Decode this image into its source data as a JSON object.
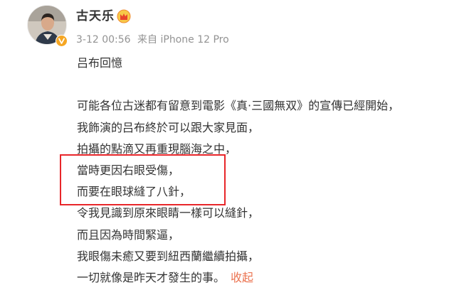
{
  "post": {
    "author": {
      "name": "古天乐",
      "avatar_icon": "avatar-portrait",
      "verified_icon": "verified-v-icon",
      "member_icon": "crown-badge-icon"
    },
    "meta": {
      "timestamp": "3-12 00:56",
      "source": "来自 iPhone 12 Pro"
    },
    "content": {
      "lines": [
        "吕布回憶",
        "",
        "可能各位古迷都有留意到電影《真·三國無双》的宣傳已經開始，",
        "我飾演的吕布終於可以跟大家見面，",
        "拍攝的點滴又再重現腦海之中，",
        "當時更因右眼受傷，",
        "而要在眼球縫了八針，",
        "令我見識到原來眼睛一樣可以縫針，",
        "而且因為時間緊逼，",
        "我眼傷未癒又要到紐西蘭繼續拍攝，",
        "一切就像是昨天才發生的事。"
      ],
      "collapse_label": "收起"
    },
    "colors": {
      "text": "#333333",
      "meta": "#939393",
      "link": "#eb7350",
      "highlight": "#e8262a",
      "verified": "#f5a623"
    }
  }
}
